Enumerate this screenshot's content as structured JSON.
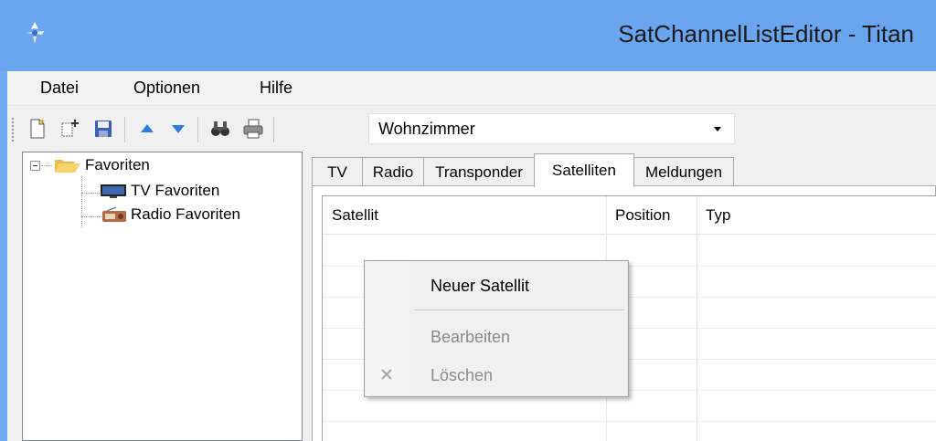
{
  "window": {
    "title": "SatChannelListEditor - Titan"
  },
  "menu": [
    "Datei",
    "Optionen",
    "Hilfe"
  ],
  "toolbar": {
    "buttons": [
      "new-document-icon",
      "new-item-icon",
      "save-icon",
      "move-up-icon",
      "move-down-icon",
      "find-icon",
      "print-icon"
    ],
    "combo_value": "Wohnzimmer"
  },
  "tree": {
    "root": "Favoriten",
    "children": [
      "TV Favoriten",
      "Radio Favoriten"
    ]
  },
  "tabs": [
    "TV",
    "Radio",
    "Transponder",
    "Satelliten",
    "Meldungen"
  ],
  "active_tab": "Satelliten",
  "grid": {
    "columns": [
      "Satellit",
      "Position",
      "Typ"
    ]
  },
  "context_menu": {
    "items": [
      {
        "label": "Neuer Satellit",
        "enabled": true
      },
      {
        "label": "Bearbeiten",
        "enabled": false
      },
      {
        "label": "Löschen",
        "enabled": false,
        "icon": "delete-x-icon"
      }
    ]
  },
  "colors": {
    "titlebar": "#6aa5ef",
    "disabled_text": "#8a8a8a"
  }
}
